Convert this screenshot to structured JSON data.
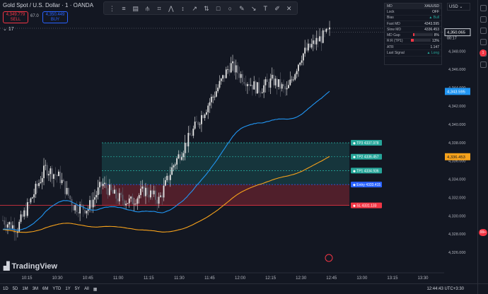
{
  "header": {
    "symbol": "Gold Spot / U.S. Dollar · 1 · OANDA",
    "sell_price": "4,349.779",
    "sell_label": "SELL",
    "buy_price": "4,350.449",
    "buy_label": "BUY",
    "spread": "67.0",
    "collapse": "17"
  },
  "panel": {
    "rows": [
      {
        "label": "MD",
        "value": "XAUUSD"
      },
      {
        "label": "Lock",
        "value": "OFF"
      },
      {
        "label": "Bias",
        "value": "▲ Bull"
      },
      {
        "label": "Fast MD",
        "value": "4343.595"
      },
      {
        "label": "Slow MD",
        "value": "4336.453"
      },
      {
        "label": "MD Gap",
        "value": "8%"
      },
      {
        "label": "R:R (TP1)",
        "value": "13%"
      },
      {
        "label": "ATR",
        "value": "1.147"
      },
      {
        "label": "Last Signal",
        "value": "▲ Long"
      }
    ]
  },
  "currency": "USD",
  "price_axis": {
    "ticks": [
      "4,348.000",
      "4,346.000",
      "4,344.000",
      "4,342.000",
      "4,340.000",
      "4,338.000",
      "4,336.000",
      "4,334.000",
      "4,332.000",
      "4,330.000",
      "4,328.000",
      "4,326.000"
    ],
    "last_price": "4,350.065",
    "countdown": "00:17",
    "fast_md_label": "4,343.595",
    "slow_md_label": "4,336.453"
  },
  "time_axis": {
    "ticks": [
      "10:15",
      "10:30",
      "10:45",
      "11:00",
      "11:15",
      "11:30",
      "11:45",
      "12:00",
      "12:15",
      "12:30",
      "12:45",
      "13:00",
      "13:15",
      "13:30"
    ]
  },
  "levels": [
    {
      "name": "tp3",
      "label": "TP3 4337.978",
      "color": "#26a69a"
    },
    {
      "name": "tp2",
      "label": "TP2 4336.457",
      "color": "#26a69a"
    },
    {
      "name": "tp1",
      "label": "TP1 4334.936",
      "color": "#26a69a"
    },
    {
      "name": "entry",
      "label": "Entry 4333.415",
      "color": "#2962ff"
    },
    {
      "name": "sl",
      "label": "SL 4331.133",
      "color": "#f23645"
    }
  ],
  "chart_data": {
    "type": "candlestick",
    "symbol": "XAUUSD",
    "ylim": [
      4325,
      4350.5
    ],
    "x_ticks": [
      "10:15",
      "10:30",
      "10:45",
      "11:00",
      "11:15",
      "11:30",
      "11:45",
      "12:00",
      "12:15",
      "12:30",
      "12:45",
      "13:00",
      "13:15",
      "13:30"
    ],
    "close_approx": [
      4329.5,
      4328.6,
      4331.8,
      4335.2,
      4334.2,
      4331.0,
      4330.8,
      4333.5,
      4332.0,
      4331.5,
      4332.8,
      4331.7,
      4335.5,
      4338.2,
      4341.0,
      4343.6,
      4346.5,
      4345.0,
      4343.8,
      4344.8,
      4343.6,
      4347.5,
      4349.0,
      4350.1
    ],
    "fast_md_end": 4343.595,
    "slow_md_end": 4336.453,
    "last_price": 4350.065
  },
  "badges": {
    "alerts": "1",
    "notif": "99+"
  },
  "bottom": {
    "ranges": [
      "1D",
      "5D",
      "1M",
      "3M",
      "6M",
      "YTD",
      "1Y",
      "5Y",
      "All"
    ],
    "clock": "12:44:43 UTC+3:30"
  },
  "logo": "TradingView"
}
